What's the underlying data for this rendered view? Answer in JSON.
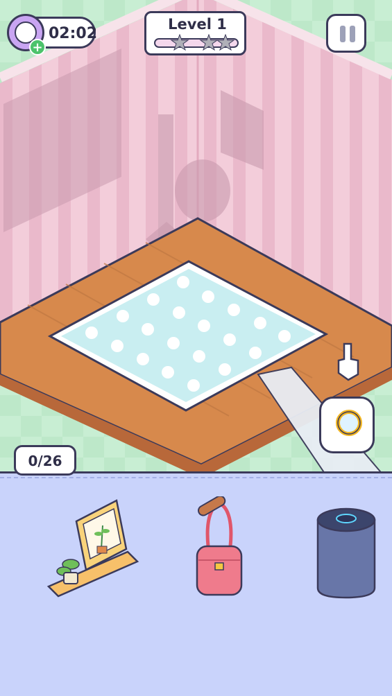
{
  "hud": {
    "timer": "02:02",
    "timer_add": "+",
    "level_label": "Level 1",
    "stars_earned": 0,
    "stars_total": 3
  },
  "progress": {
    "found_label": "0/26",
    "found": 0,
    "total": 26
  },
  "tray": {
    "items": [
      "picture-frame-shelf",
      "pink-handbag",
      "smart-speaker"
    ]
  },
  "colors": {
    "wall": "#f1c6d6",
    "floor": "#d7894c",
    "rug": "#c9eef1",
    "tray": "#c9d3fb",
    "outline": "#3b3a5a"
  }
}
